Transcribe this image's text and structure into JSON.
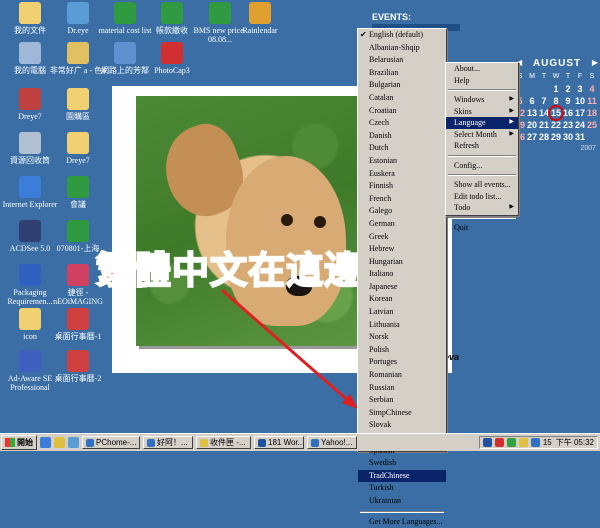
{
  "desktop_icons": [
    {
      "label": "我的文件",
      "color": "#f0d070"
    },
    {
      "label": "Dr.eye",
      "color": "#5a9cd6"
    },
    {
      "label": "material cost list",
      "color": "#2f9a3f"
    },
    {
      "label": "帳款繳收",
      "color": "#2f9a3f"
    },
    {
      "label": "BMS new price-08.08...",
      "color": "#2f9a3f"
    },
    {
      "label": "Rainlendar",
      "color": "#e0a030"
    },
    {
      "label": "我的電腦",
      "color": "#a0b8d8"
    },
    {
      "label": "非常好广 a - 色4",
      "color": "#e0c060"
    },
    {
      "label": "網路上的芳鄰",
      "color": "#6090d0"
    },
    {
      "label": "PhotoCap3",
      "color": "#d03030"
    },
    {
      "label": "Dreye7",
      "color": "#c04040"
    },
    {
      "label": "園購區",
      "color": "#f0d070"
    },
    {
      "label": "資源回收筒",
      "color": "#b0c0d0"
    },
    {
      "label": "Dreye7",
      "color": "#f0d070"
    },
    {
      "label": "Internet Explorer",
      "color": "#3b7dd8"
    },
    {
      "label": "會議",
      "color": "#2f9a3f"
    },
    {
      "label": "ACDSee 5.0",
      "color": "#304070"
    },
    {
      "label": "070801-上海",
      "color": "#2f9a3f"
    },
    {
      "label": "Packaging Requiremen...",
      "color": "#3060c0"
    },
    {
      "label": "捷徑 - nEOiMAGING",
      "color": "#d04060"
    },
    {
      "label": "icon",
      "color": "#f0d070"
    },
    {
      "label": "桌面行事曆-1",
      "color": "#d04040"
    },
    {
      "label": "Ad-Aware SE Professional",
      "color": "#4060c0"
    },
    {
      "label": "桌面行事曆-2",
      "color": "#d04040"
    }
  ],
  "events_label": "EVENTS:",
  "calendar": {
    "month": "AUGUST",
    "prev_icon": "left-arrow-icon",
    "next_icon": "right-arrow-icon",
    "day_names": [
      "S",
      "M",
      "T",
      "W",
      "T",
      "F",
      "S"
    ],
    "weeks": [
      [
        "",
        "",
        "",
        "1",
        "2",
        "3",
        "4"
      ],
      [
        "5",
        "6",
        "7",
        "8",
        "9",
        "10",
        "11"
      ],
      [
        "12",
        "13",
        "14",
        "15",
        "16",
        "17",
        "18"
      ],
      [
        "19",
        "20",
        "21",
        "22",
        "23",
        "24",
        "25"
      ],
      [
        "26",
        "27",
        "28",
        "29",
        "30",
        "31",
        ""
      ]
    ],
    "today": "15",
    "year": "2007"
  },
  "photo_credit": "o by eva",
  "annotation_text": "繁體中文在這邊",
  "language_menu": {
    "checked": "English (default)",
    "selected": "TradChinese",
    "items": [
      "English (default)",
      "Albanian-Shqip",
      "Belarusian",
      "Brazilian",
      "Bulgarian",
      "Catalan",
      "Croatian",
      "Czech",
      "Danish",
      "Dutch",
      "Estonian",
      "Euskera",
      "Finnish",
      "French",
      "Galego",
      "German",
      "Greek",
      "Hebrew",
      "Hungarian",
      "Italiano",
      "Japanese",
      "Korean",
      "Latvian",
      "Lithuania",
      "Norsk",
      "Polish",
      "Portuges",
      "Romanian",
      "Russian",
      "Serbian",
      "SimpChinese",
      "Slovak",
      "Slovenian",
      "Spanish",
      "Swedish",
      "TradChinese",
      "Turkish",
      "Ukrainian"
    ],
    "more_label": "Get More Languages..."
  },
  "context_menu": {
    "items": [
      {
        "label": "About...",
        "sub": false,
        "sep_after": false
      },
      {
        "label": "Help",
        "sub": false,
        "sep_after": true
      },
      {
        "label": "Windows",
        "sub": true,
        "sep_after": false
      },
      {
        "label": "Skins",
        "sub": true,
        "sep_after": false
      },
      {
        "label": "Language",
        "sub": true,
        "sep_after": false,
        "selected": true
      },
      {
        "label": "Select Month",
        "sub": true,
        "sep_after": false
      },
      {
        "label": "Refresh",
        "sub": false,
        "sep_after": true
      },
      {
        "label": "Config...",
        "sub": false,
        "sep_after": true
      },
      {
        "label": "Show all events...",
        "sub": false,
        "sep_after": false
      },
      {
        "label": "Edit todo list...",
        "sub": false,
        "sep_after": false
      },
      {
        "label": "Todo",
        "sub": true,
        "sep_after": true
      },
      {
        "label": "Quit",
        "sub": false,
        "sep_after": false
      }
    ]
  },
  "taskbar": {
    "start_label": "開始",
    "buttons": [
      {
        "label": "PChome-...",
        "color": "#3070c0"
      },
      {
        "label": "好阿！...",
        "color": "#3070c0"
      },
      {
        "label": "收件匣 -...",
        "color": "#e0c040"
      },
      {
        "label": "181 Wor...",
        "color": "#2050a0"
      },
      {
        "label": "Yahoo!...",
        "color": "#3070c0"
      }
    ],
    "tray_number": "15",
    "clock": "下午 05:32"
  }
}
